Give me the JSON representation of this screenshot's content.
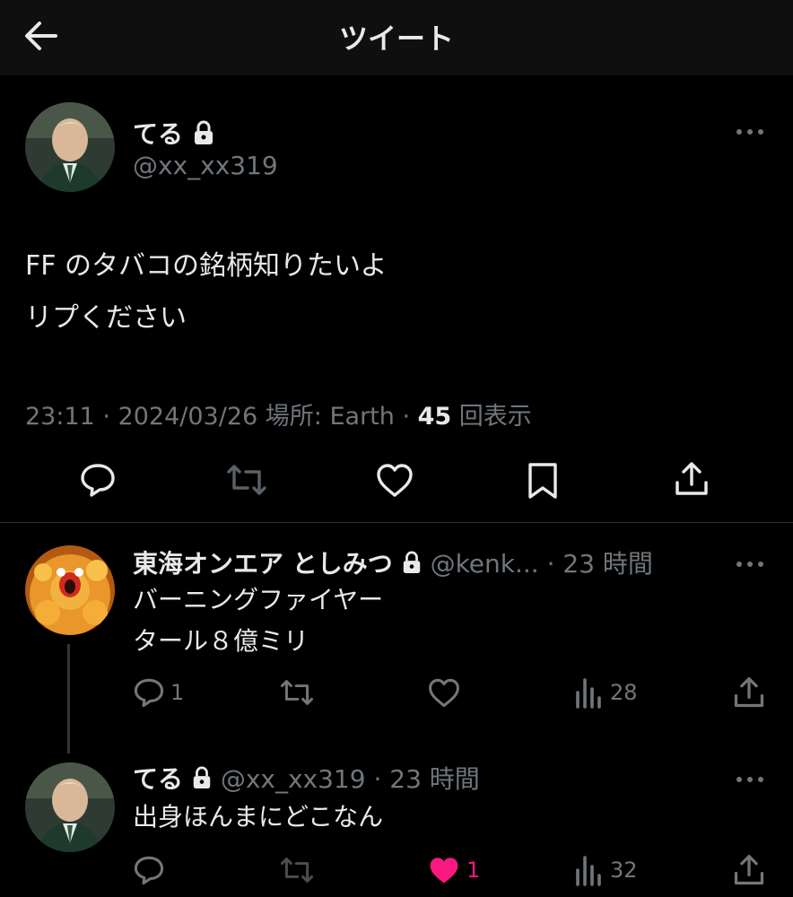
{
  "header": {
    "title": "ツイート"
  },
  "colors": {
    "background": "#000000",
    "text": "#e7e9ea",
    "muted": "#71767b",
    "like_active": "#f91880"
  },
  "tweet": {
    "name": "てる",
    "handle": "@xx_xx319",
    "text_lines": [
      "FF のタバコの銘柄知りたいよ",
      "リプください"
    ],
    "time": "23:11",
    "date": "2024/03/26",
    "location_label": "場所: Earth",
    "views": "45",
    "views_label": "回表示"
  },
  "replies": [
    {
      "name": "東海オンエア としみつ",
      "handle": "@kenk...",
      "time": "23 時間",
      "text_lines": [
        "バーニングファイヤー",
        "タール８億ミリ"
      ],
      "reply_count": "1",
      "retweet_count": "",
      "like_count": "",
      "view_count": "28",
      "liked": false
    },
    {
      "name": "てる",
      "handle": "@xx_xx319",
      "time": "23 時間",
      "text_lines": [
        "出身ほんまにどこなん"
      ],
      "reply_count": "",
      "retweet_count": "",
      "like_count": "1",
      "view_count": "32",
      "liked": true
    }
  ]
}
